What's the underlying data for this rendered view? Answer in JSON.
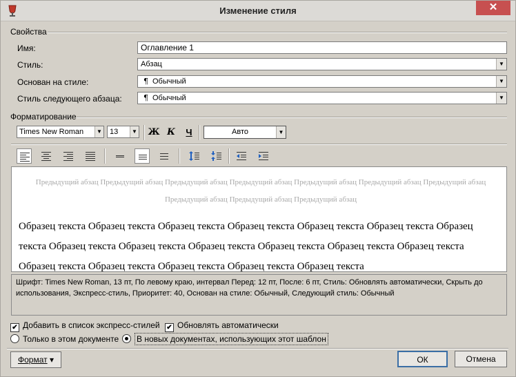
{
  "window": {
    "title": "Изменение стиля",
    "close_glyph": "✕"
  },
  "properties": {
    "section_label": "Свойства",
    "name_label": "Имя:",
    "name_value": "Оглавление 1",
    "style_label": "Стиль:",
    "style_value": "Абзац",
    "based_on_label": "Основан на стиле:",
    "based_on_value": "Обычный",
    "next_style_label": "Стиль следующего абзаца:",
    "next_style_value": "Обычный",
    "pilcrow": "¶"
  },
  "formatting": {
    "section_label": "Форматирование",
    "font": "Times New Roman",
    "size": "13",
    "bold_glyph": "Ж",
    "italic_glyph": "К",
    "underline_glyph": "Ч",
    "color": "Авто"
  },
  "preview": {
    "previous_paragraph_line1": "Предыдущий абзац Предыдущий абзац Предыдущий абзац Предыдущий абзац Предыдущий абзац Предыдущий абзац Предыдущий абзац Предыдущий абзац Предыдущий абзац Предыдущий абзац",
    "sample_text": "Образец текста Образец текста Образец текста Образец текста Образец текста Образец текста Образец текста Образец текста Образец текста Образец текста Образец текста Образец текста Образец текста Образец текста Образец текста Образец текста Образец текста Образец текста"
  },
  "description": "Шрифт: Times New Roman, 13 пт, По левому краю, интервал Перед:  12 пт, После:  6 пт, Стиль: Обновлять автоматически, Скрыть до использования, Экспресс-стиль, Приоритет: 40, Основан на стиле: Обычный, Следующий стиль: Обычный",
  "options": {
    "add_to_quick_styles": "Добавить в список экспресс-стилей",
    "auto_update": "Обновлять автоматически",
    "only_this_document": "Только в этом документе",
    "new_documents": "В новых документах, использующих этот шаблон",
    "checkmark": "✔"
  },
  "buttons": {
    "format": "Формат",
    "ok": "ОК",
    "cancel": "Отмена",
    "dropdown_glyph": "▾",
    "combo_arrow": "▼"
  },
  "colors": {
    "close_red": "#c75050",
    "dialog_bg": "#d4d0c8",
    "preview_gray": "#a8a8a8"
  }
}
